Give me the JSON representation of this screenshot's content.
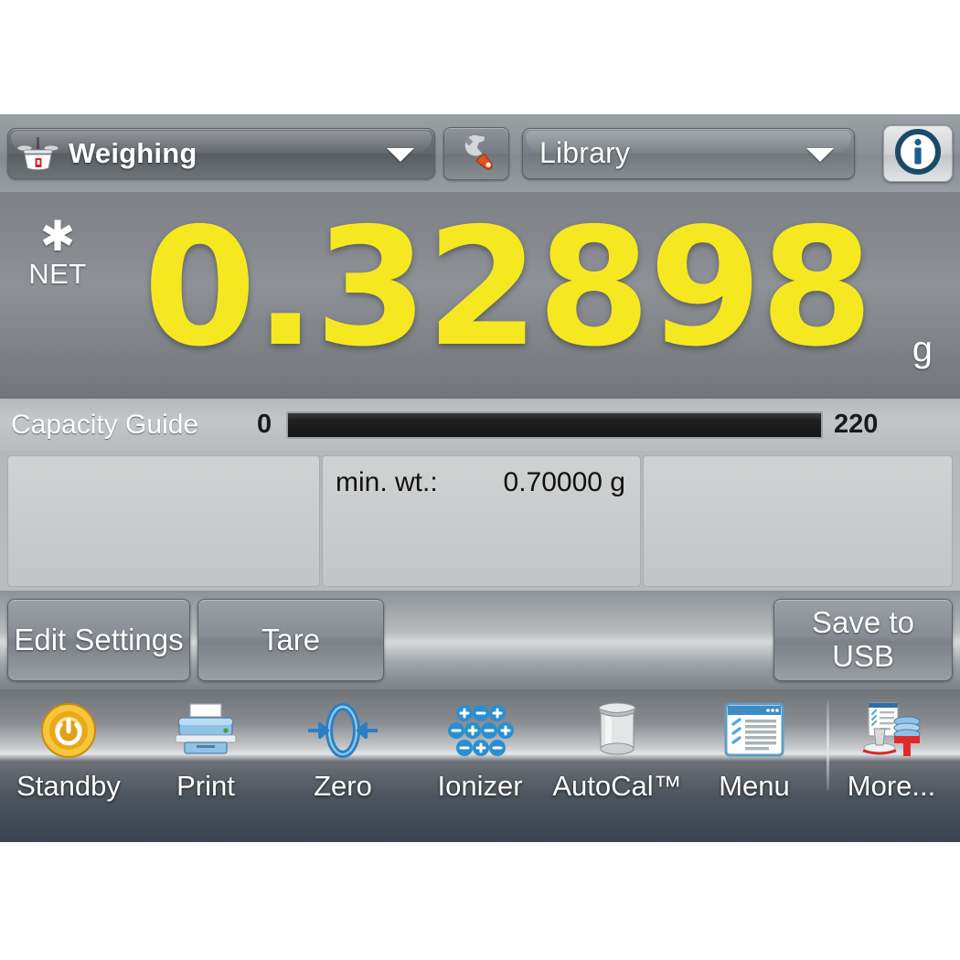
{
  "header": {
    "app_selector": {
      "icon": "balance-scale-icon",
      "label": "Weighing",
      "caret": "chevron-down-icon"
    },
    "settings_button": {
      "icon": "wrench-icon"
    },
    "library_selector": {
      "label": "Library",
      "caret": "chevron-down-icon"
    },
    "info_button": {
      "icon": "info-icon"
    }
  },
  "display": {
    "star_indicator": "✱",
    "net_indicator": "NET",
    "weight": "0.32898",
    "unit": "g"
  },
  "capacity": {
    "label": "Capacity Guide",
    "min": "0",
    "max": "220",
    "fill_percent": 0
  },
  "panels": {
    "left": {
      "key": "",
      "value": ""
    },
    "middle": {
      "key": "min. wt.:",
      "value": "0.70000 g"
    },
    "right": {
      "key": "",
      "value": ""
    }
  },
  "actions": {
    "edit_settings": "Edit Settings",
    "tare": "Tare",
    "save_to_usb": "Save to\nUSB",
    "save_to_usb_line1": "Save to",
    "save_to_usb_line2": "USB"
  },
  "toolbar": [
    {
      "label": "Standby",
      "icon": "power-standby-icon"
    },
    {
      "label": "Print",
      "icon": "printer-icon"
    },
    {
      "label": "Zero",
      "icon": "zero-arrows-icon"
    },
    {
      "label": "Ionizer",
      "icon": "ionizer-charges-icon"
    },
    {
      "label": "AutoCal™",
      "icon": "calibration-weight-icon"
    },
    {
      "label": "Menu",
      "icon": "menu-window-list-icon"
    },
    {
      "label": "More...",
      "icon": "more-applications-icon"
    }
  ],
  "colors": {
    "weight_yellow": "#f6e820",
    "panel_gray": "#c8cacb",
    "chrome_gray": "#8c9095",
    "toolbar_dark": "#3b434e",
    "wrench_orange": "#e04a18",
    "icon_blue": "#2d7fc1",
    "standby_gold": "#f0b41f"
  }
}
